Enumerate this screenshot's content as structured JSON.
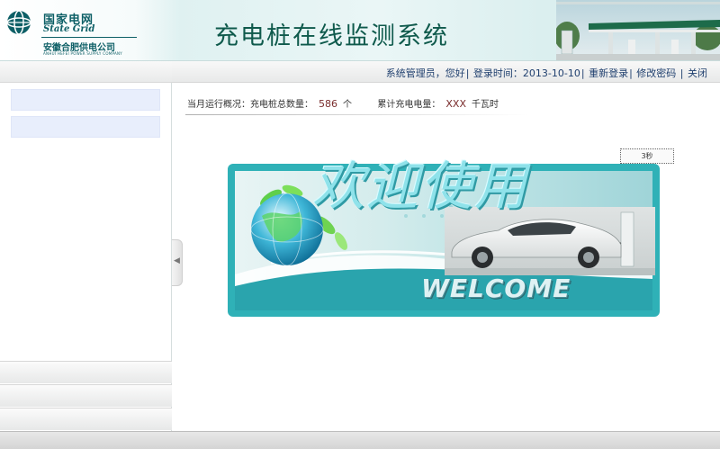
{
  "header": {
    "logo_cn": "国家电网",
    "logo_en": "State Grid",
    "logo_sub": "安徽合肥供电公司",
    "logo_sub_en": "ANHUI HEFEI POWER SUPPLY COMPANY",
    "title": "充电桩在线监测系统"
  },
  "topbar": {
    "greeting": "系统管理员，您好",
    "login_time_label": "登录时间：",
    "login_time": "2013-10-10",
    "relogin": "重新登录",
    "change_password": "修改密码",
    "close": "关闭"
  },
  "overview": {
    "label": "当月运行概况：",
    "pile_count_label": "充电桩总数量：",
    "pile_count": "586",
    "pile_unit": "个",
    "energy_label": "累计充电电量：",
    "energy_value": "XXX",
    "energy_unit": "千瓦时"
  },
  "timer": "3秒",
  "banner": {
    "welcome_cn": "欢迎使用",
    "welcome_en": "WELCOME"
  },
  "colors": {
    "brand": "#0d5f66",
    "banner_frame": "#2fb1b7",
    "value_text": "#7a2d2d",
    "link_text": "#1f3f6e"
  }
}
